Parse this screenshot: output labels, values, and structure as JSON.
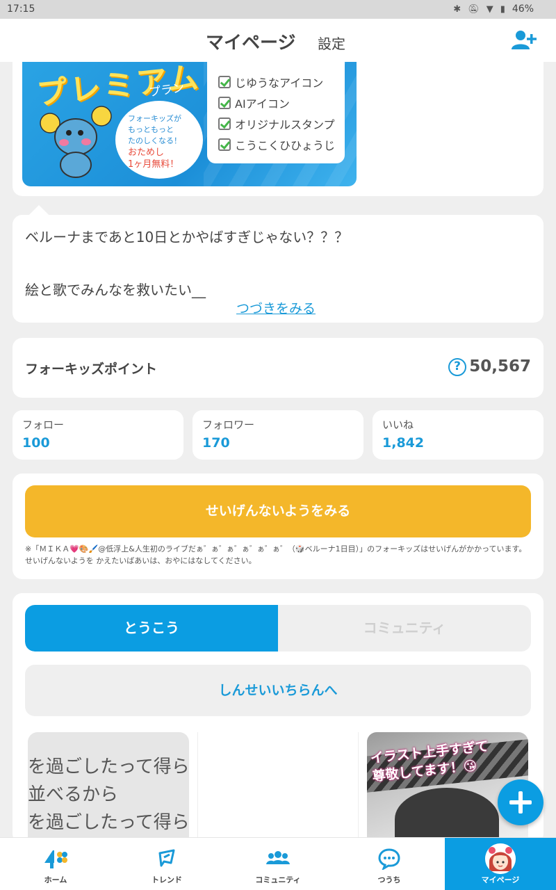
{
  "status_bar": {
    "time": "17:15",
    "battery": "46%"
  },
  "app_bar": {
    "title": "マイページ",
    "settings_label": "設定"
  },
  "premium_banner": {
    "title": "プレミアム",
    "plan": "プラン",
    "bubble_lines": [
      "フォーキッズが",
      "もっともっと",
      "たのしくなる！"
    ],
    "trial_lines": [
      "おためし",
      "1ヶ月無料！"
    ],
    "features": [
      "じゆうなアイコン",
      "AIアイコン",
      "オリジナルスタンプ",
      "こうこくひひょうじ"
    ]
  },
  "bio": {
    "line1": "ベルーナまであと10日とかやばすぎじゃない？？？",
    "line2": "絵と歌でみんなを救いたい__",
    "more_link": "つづきをみる"
  },
  "points": {
    "label": "フォーキッズポイント",
    "help": "?",
    "value": "50,567"
  },
  "stats": [
    {
      "label": "フォロー",
      "value": "100"
    },
    {
      "label": "フォロワー",
      "value": "170"
    },
    {
      "label": "いいね",
      "value": "1,842"
    }
  ],
  "limits": {
    "button_label": "せいげんないようをみる",
    "note": "※「ＭＩＫＡ💗🎨🖌️@低浮上&人生初のライブだぁ゛ぁ゛ぁ゛ぁ゛ぁ゛ぁ゛（🎲ベルーナ1日目）」のフォーキッズはせいげんがかかっています。せいげんないようを かえたいばあいは、おやにはなしてください。"
  },
  "posts": {
    "tabs": [
      "とうこう",
      "コミュニティ"
    ],
    "apply_button": "しんせいいちらんへ",
    "thumb1_lines": [
      "を過ごしたって得ら",
      "並べるから",
      "を過ごしたって得ら"
    ],
    "thumb3_lines": [
      "イラスト上手すぎて",
      "尊敬してます！😘"
    ]
  },
  "bottom_nav": [
    {
      "label": "ホーム",
      "icon": "home-icon"
    },
    {
      "label": "トレンド",
      "icon": "trend-icon"
    },
    {
      "label": "コミュニティ",
      "icon": "community-icon"
    },
    {
      "label": "つうち",
      "icon": "notification-icon"
    },
    {
      "label": "マイページ",
      "icon": "avatar-icon"
    }
  ],
  "colors": {
    "primary": "#0b9de2",
    "accent": "#f4b72a",
    "background": "#efefef"
  }
}
